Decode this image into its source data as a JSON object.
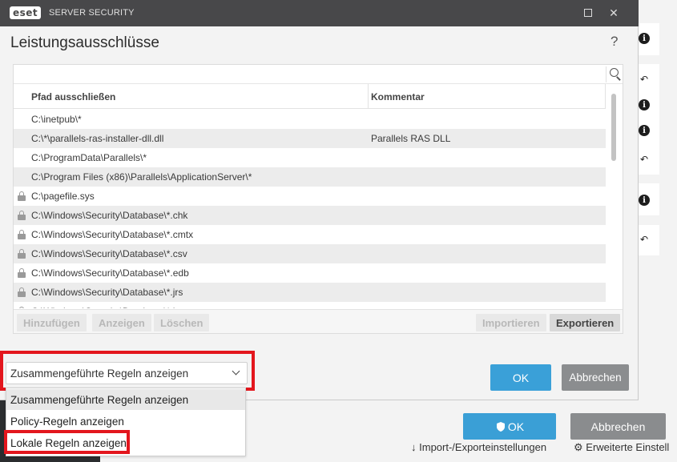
{
  "window": {
    "logo": "eset",
    "app_name": "SERVER SECURITY",
    "heading": "Leistungsausschlüsse",
    "help": "?"
  },
  "table": {
    "columns": [
      "Pfad ausschließen",
      "Kommentar"
    ],
    "rows": [
      {
        "path": "C:\\inetpub\\*",
        "comment": "",
        "locked": false
      },
      {
        "path": "C:\\*\\parallels-ras-installer-dll.dll",
        "comment": "Parallels RAS DLL",
        "locked": false
      },
      {
        "path": "C:\\ProgramData\\Parallels\\*",
        "comment": "",
        "locked": false
      },
      {
        "path": "C:\\Program Files (x86)\\Parallels\\ApplicationServer\\*",
        "comment": "",
        "locked": false
      },
      {
        "path": "C:\\pagefile.sys",
        "comment": "",
        "locked": true
      },
      {
        "path": "C:\\Windows\\Security\\Database\\*.chk",
        "comment": "",
        "locked": true
      },
      {
        "path": "C:\\Windows\\Security\\Database\\*.cmtx",
        "comment": "",
        "locked": true
      },
      {
        "path": "C:\\Windows\\Security\\Database\\*.csv",
        "comment": "",
        "locked": true
      },
      {
        "path": "C:\\Windows\\Security\\Database\\*.edb",
        "comment": "",
        "locked": true
      },
      {
        "path": "C:\\Windows\\Security\\Database\\*.jrs",
        "comment": "",
        "locked": true
      },
      {
        "path": "C:\\Windows\\Security\\Database\\*.log",
        "comment": "",
        "locked": true
      }
    ]
  },
  "toolbar": {
    "add": "Hinzufügen",
    "show": "Anzeigen",
    "delete": "Löschen",
    "import": "Importieren",
    "export": "Exportieren"
  },
  "filter": {
    "selected": "Zusammengeführte Regeln anzeigen",
    "options": [
      "Zusammengeführte Regeln anzeigen",
      "Policy-Regeln anzeigen",
      "Lokale Regeln anzeigen"
    ]
  },
  "buttons": {
    "ok": "OK",
    "cancel": "Abbrechen"
  },
  "background": {
    "ok": "OK",
    "cancel": "Abbrechen",
    "import_export": "Import-/Exporteinstellungen",
    "advanced": "Erweiterte Einstell"
  },
  "colors": {
    "highlight": "#e3161d",
    "primary": "#3aa0d8",
    "secondary": "#8b8d8f",
    "titlebar": "#48484a"
  }
}
